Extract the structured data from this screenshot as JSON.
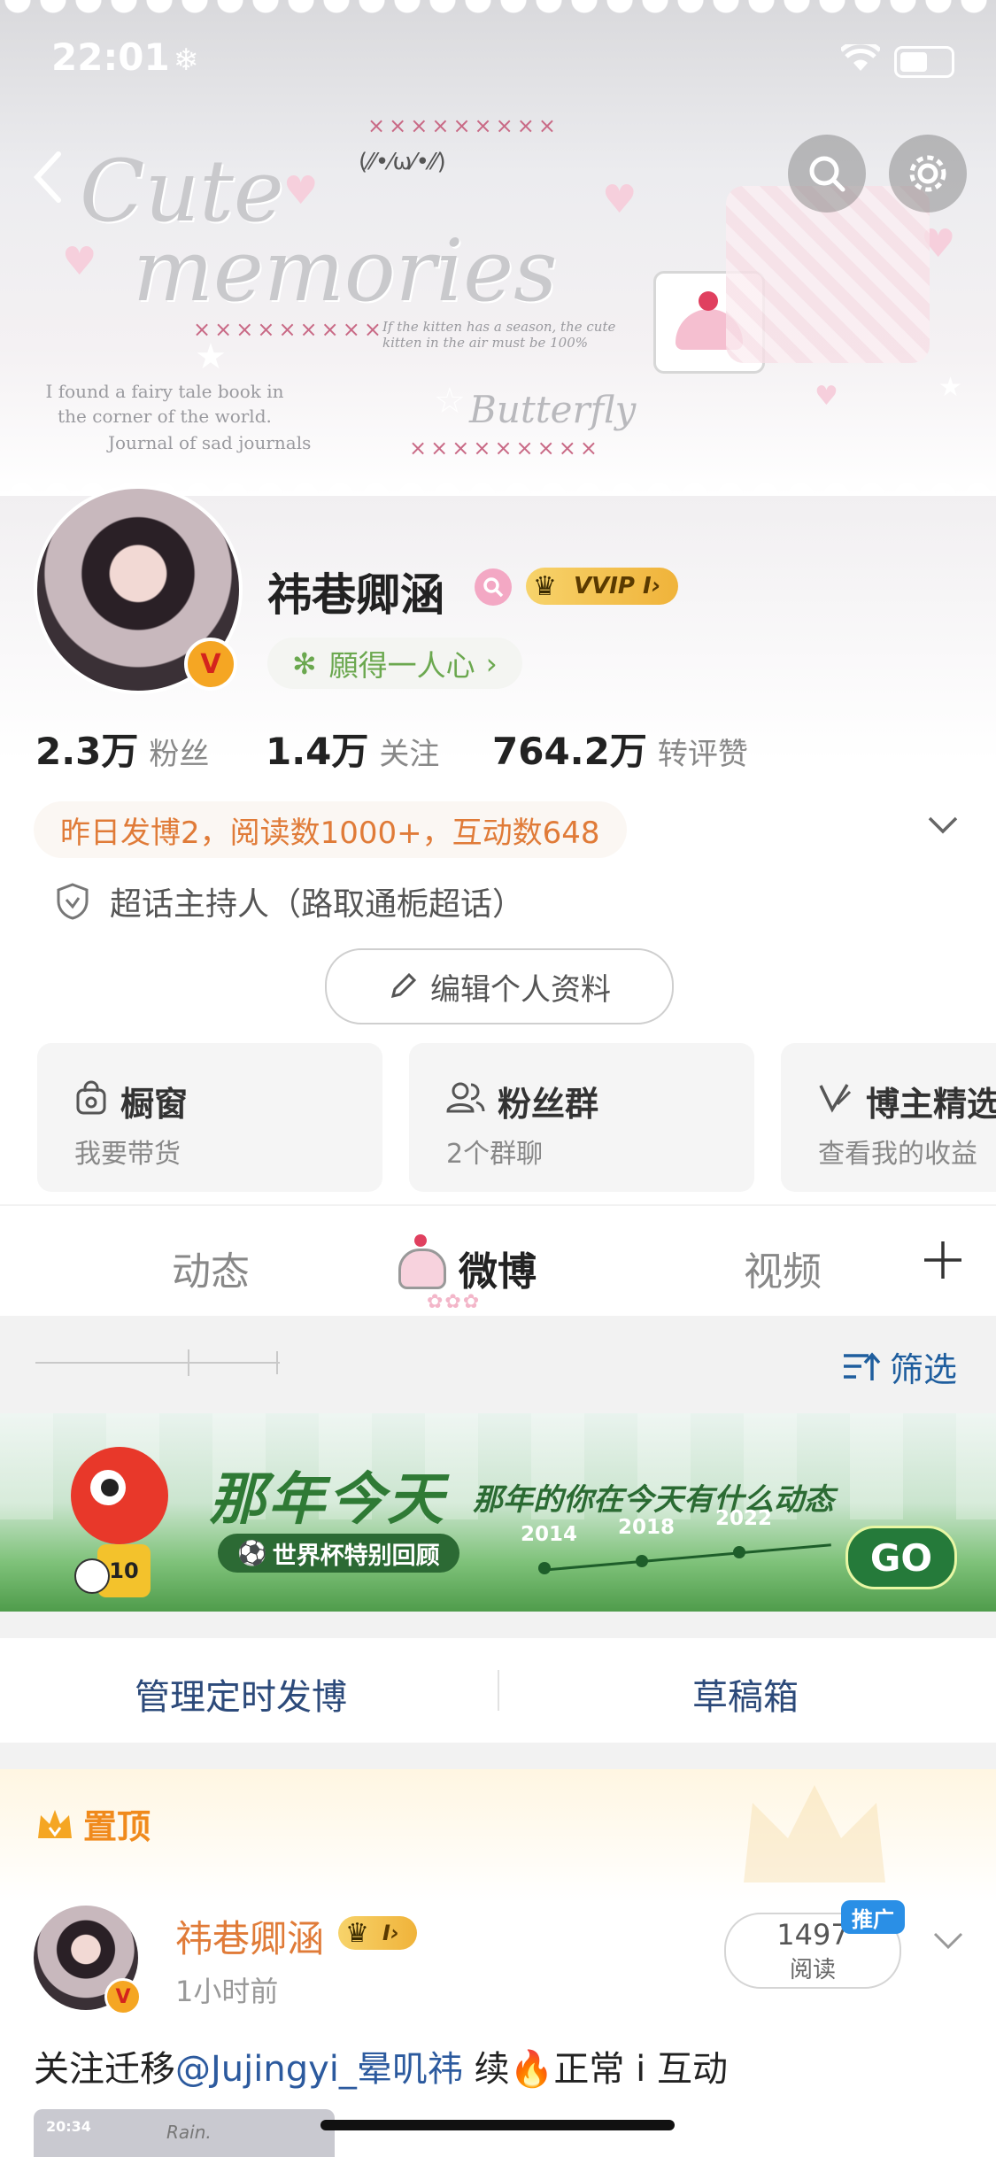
{
  "status_bar": {
    "time": "22:01",
    "weather_icon": "snowflake-icon"
  },
  "banner": {
    "title_line1": "Cute",
    "title_line2": "memories",
    "kaomoji": "(⁄⁄•⁄ω⁄•⁄⁄)",
    "crosses": "×××××××××",
    "kitten_text": "If the kitten has a season, the cute kitten in the air must be 100%",
    "fairy_text": "I found a fairy tale book in the corner of the world.",
    "journal_text": "Journal of sad journals",
    "butterfly_text": "Butterfly"
  },
  "profile": {
    "name": "祎巷卿涵",
    "vvip_label": "VVIP I",
    "motto": "願得一人心",
    "verified_badge": "V",
    "stats": [
      {
        "value": "2.3万",
        "label": "粉丝"
      },
      {
        "value": "1.4万",
        "label": "关注"
      },
      {
        "value": "764.2万",
        "label": "转评赞"
      }
    ],
    "yesterday_summary": "昨日发博2，阅读数1000+，互动数648",
    "host_text": "超话主持人（路取通栀超话）",
    "edit_label": "编辑个人资料"
  },
  "cards": [
    {
      "title": "橱窗",
      "sub": "我要带货",
      "icon": "bag-icon"
    },
    {
      "title": "粉丝群",
      "sub": "2个群聊",
      "icon": "group-icon"
    },
    {
      "title": "博主精选",
      "sub": "查看我的收益",
      "icon": "v-icon"
    }
  ],
  "tabs": {
    "dynamic": "动态",
    "weibo": "微博",
    "video": "视频",
    "add": "+"
  },
  "filter": {
    "label": "筛选"
  },
  "promo": {
    "title": "那年今天",
    "subtitle": "那年的你在今天有什么动态",
    "tag": "世界杯特别回顾",
    "years": [
      "2014",
      "2018",
      "2022"
    ],
    "go": "GO"
  },
  "manage": {
    "scheduled": "管理定时发博",
    "drafts": "草稿箱"
  },
  "pinned": {
    "label": "置顶",
    "author": "祎巷卿涵",
    "member_label": "I",
    "time": "1小时前",
    "read_count": "1497",
    "read_label": "阅读",
    "promo_badge": "推广",
    "text_before": "关注迁移",
    "mention": "@Jujingyi_晕叽祎",
    "text_after": " 续🔥正常 i 互动",
    "thumb_time": "20:34",
    "thumb_text": "Rain."
  },
  "colors": {
    "accent_orange": "#e07b38",
    "link_blue": "#2c5a9e",
    "motto_green": "#6ba84f",
    "promo_green": "#2f7a35"
  }
}
